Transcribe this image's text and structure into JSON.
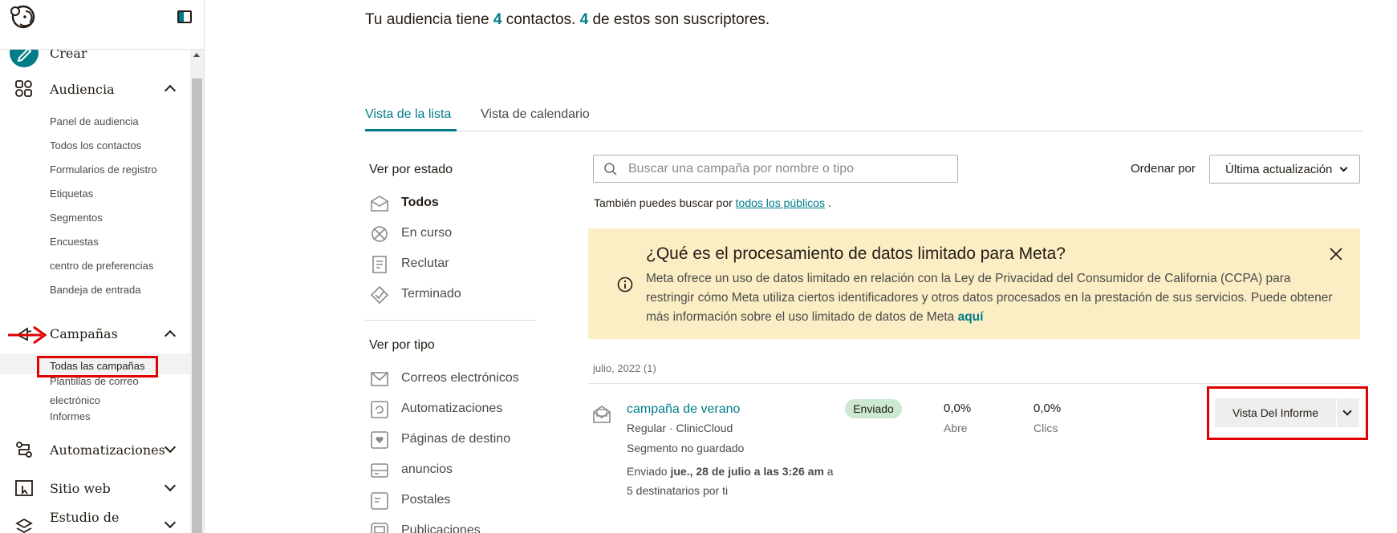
{
  "sidebar": {
    "collapse_icon": "sidebar-collapse-icon",
    "items": [
      {
        "label": "Crear",
        "icon": "pencil-icon"
      },
      {
        "label": "Audiencia",
        "icon": "audience-icon",
        "expanded": true,
        "children": [
          "Panel de audiencia",
          "Todos los contactos",
          "Formularios de registro",
          "Etiquetas",
          "Segmentos",
          "Encuestas",
          "centro de preferencias",
          "Bandeja de entrada"
        ]
      },
      {
        "label": "Campañas",
        "icon": "campaigns-icon",
        "expanded": true,
        "children": [
          "Todas las campañas",
          "Plantillas de correo",
          "electrónico",
          "Informes"
        ],
        "active_child": "Todas las campañas"
      },
      {
        "label": "Automatizaciones",
        "icon": "automation-icon",
        "expanded": false
      },
      {
        "label": "Sitio web",
        "icon": "website-icon",
        "expanded": false
      },
      {
        "label": "Estudio de",
        "icon": "studio-icon",
        "expanded": false
      }
    ]
  },
  "audience_summary": {
    "prefix": "Tu audiencia tiene",
    "contacts": "4",
    "middle": "contactos.",
    "subscribers": "4",
    "suffix": "de estos son suscriptores."
  },
  "tabs": [
    {
      "label": "Vista de la lista",
      "active": true
    },
    {
      "label": "Vista de calendario",
      "active": false
    }
  ],
  "filters": {
    "status_heading": "Ver por estado",
    "status_items": [
      {
        "label": "Todos",
        "icon": "all-icon",
        "active": true
      },
      {
        "label": "En curso",
        "icon": "in-progress-icon"
      },
      {
        "label": "Reclutar",
        "icon": "draft-icon"
      },
      {
        "label": "Terminado",
        "icon": "completed-icon"
      }
    ],
    "type_heading": "Ver por tipo",
    "type_items": [
      {
        "label": "Correos electrónicos",
        "icon": "email-icon"
      },
      {
        "label": "Automatizaciones",
        "icon": "automation-icon"
      },
      {
        "label": "Páginas de destino",
        "icon": "landing-page-icon"
      },
      {
        "label": "anuncios",
        "icon": "ads-icon"
      },
      {
        "label": "Postales",
        "icon": "postcard-icon"
      },
      {
        "label": "Publicaciones",
        "icon": "social-post-icon"
      }
    ]
  },
  "search": {
    "placeholder": "Buscar una campaña por nombre o tipo",
    "value": "",
    "also_prefix": "También puedes buscar por",
    "also_link": "todos los públicos",
    "also_suffix": "."
  },
  "sort": {
    "label": "Ordenar por",
    "value": "Última actualización"
  },
  "banner": {
    "title": "¿Qué es el procesamiento de datos limitado para Meta?",
    "body": "Meta ofrece un uso de datos limitado en relación con la Ley de Privacidad del Consumidor de California (CCPA) para restringir cómo Meta utiliza ciertos identificadores y otros datos procesados en la prestación de sus servicios. Puede obtener más información sobre el uso limitado de datos de Meta",
    "link": "aquí"
  },
  "campaign_group": {
    "heading": "julio, 2022 (1)",
    "campaigns": [
      {
        "name": "campaña de verano",
        "type_audience": "Regular · ClinicCloud",
        "segment": "Segmento no guardado",
        "sent_prefix": "Enviado",
        "sent_date": "jue., 28 de julio a las 3:26 am",
        "sent_suffix": "a",
        "recipients": "5 destinatarios por ti",
        "status": "Enviado",
        "open_rate": "0,0%",
        "open_label": "Abre",
        "click_rate": "0,0%",
        "click_label": "Clics",
        "action": "Vista Del Informe"
      }
    ]
  },
  "colors": {
    "accent": "#007c89",
    "banner_bg": "#fbeec5",
    "badge_bg": "#cce8d1",
    "annotation": "#e00000"
  }
}
